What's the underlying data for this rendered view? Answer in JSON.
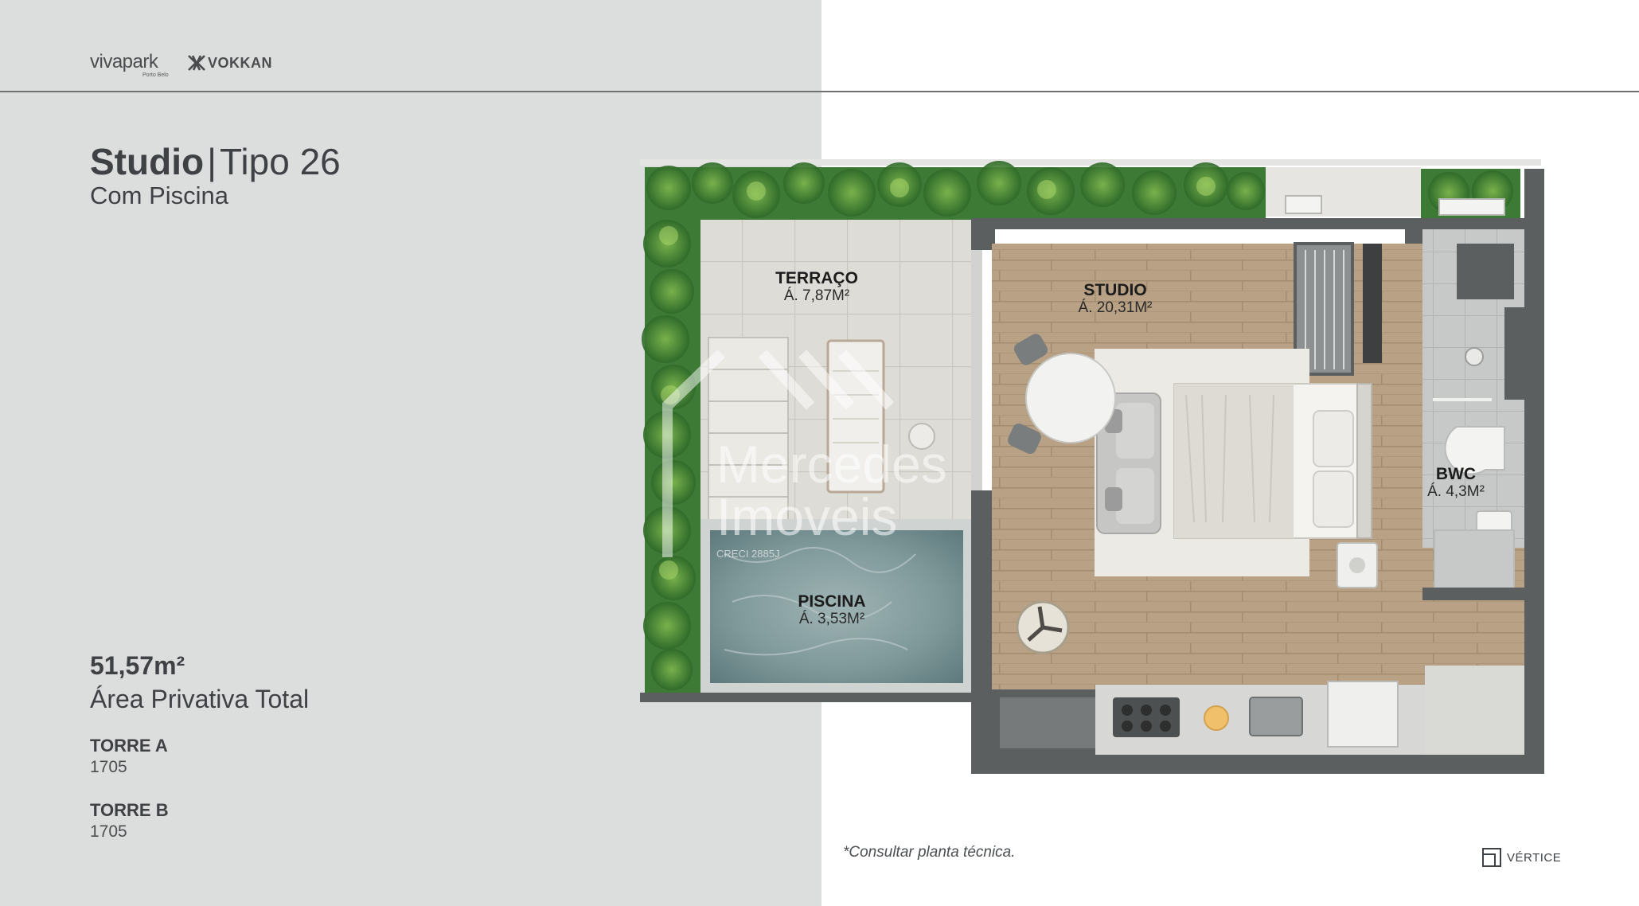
{
  "header": {
    "brand_primary": "vivapark",
    "brand_primary_sub": "Porto Belo",
    "brand_secondary": "VOKKAN"
  },
  "unit": {
    "name": "Studio",
    "separator": "|",
    "type": "Tipo 26",
    "subtitle": "Com Piscina"
  },
  "summary": {
    "total_area": "51,57m²",
    "total_area_label": "Área Privativa Total"
  },
  "towers": [
    {
      "name": "TORRE A",
      "unit": "1705"
    },
    {
      "name": "TORRE B",
      "unit": "1705"
    }
  ],
  "floor_plan": {
    "rooms": [
      {
        "label": "TERRAÇO",
        "area": "Á. 7,87M²"
      },
      {
        "label": "STUDIO",
        "area": "Á. 20,31M²"
      },
      {
        "label": "BWC",
        "area": "Á. 4,3M²"
      },
      {
        "label": "PISCINA",
        "area": "Á. 3,53M²"
      }
    ]
  },
  "watermark": {
    "line1": "Mercedes",
    "line2": "Imoveis",
    "registry": "CRECI 2885J"
  },
  "footer": {
    "note": "*Consultar planta técnica.",
    "brand": "VÉRTICE"
  },
  "colors": {
    "left_panel": "#dcdddd",
    "text": "#3f4245",
    "wall": "#5b5f5f",
    "wood_floor": "#b59e82",
    "terrace_tile": "#dedcd6",
    "pool_water": "#7e989a",
    "garden_green": "#3d7a35"
  }
}
